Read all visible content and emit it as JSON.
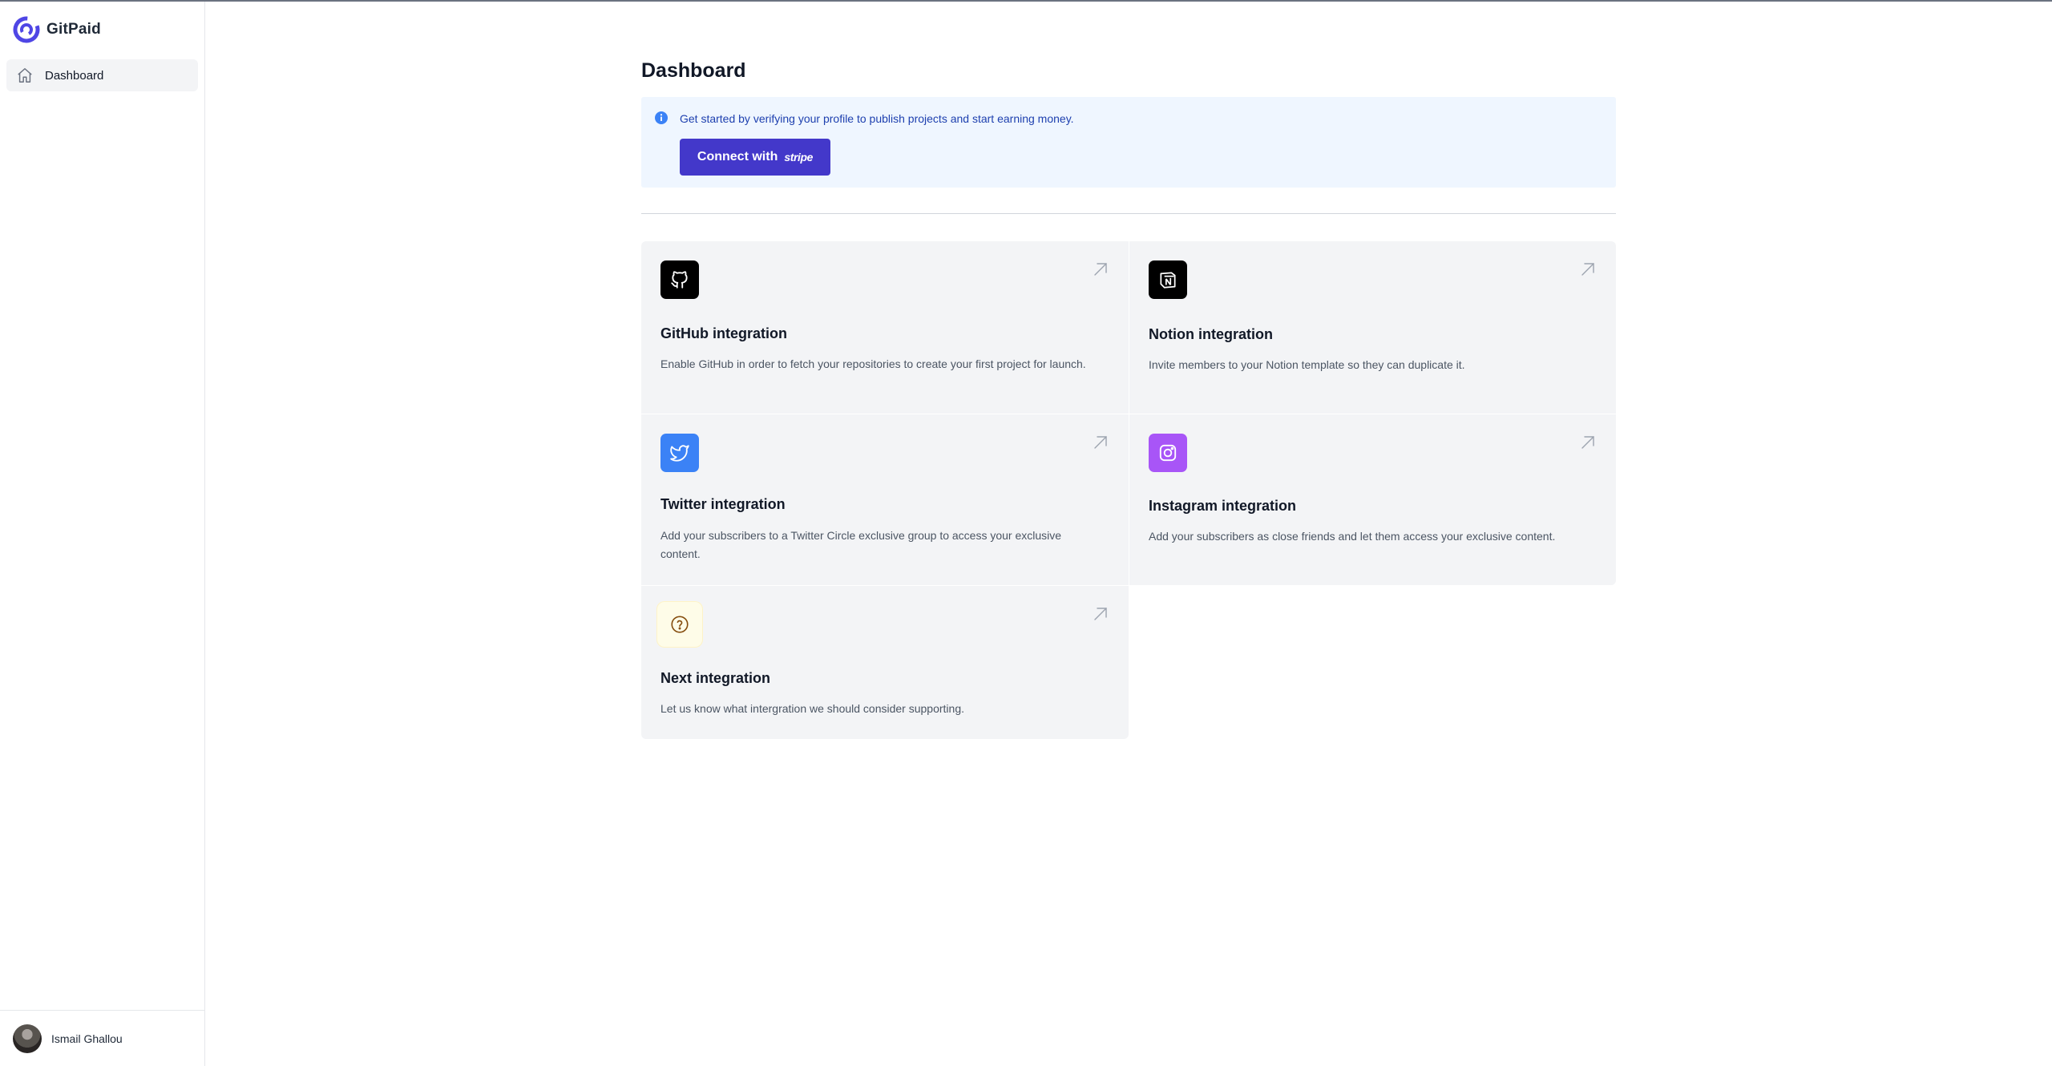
{
  "sidebar": {
    "brand": "GitPaid",
    "nav": [
      {
        "label": "Dashboard",
        "icon": "home-icon"
      }
    ],
    "user": {
      "name": "Ismail Ghallou"
    }
  },
  "main": {
    "title": "Dashboard",
    "alert": {
      "text": "Get started by verifying your profile to publish projects and start earning money.",
      "button_label": "Connect with",
      "button_brand": "stripe"
    },
    "cards": [
      {
        "title": "GitHub integration",
        "description": "Enable GitHub in order to fetch your repositories to create your first project for launch.",
        "icon": "github-icon",
        "color": "#000000"
      },
      {
        "title": "Notion integration",
        "description": "Invite members to your Notion template so they can duplicate it.",
        "icon": "notion-icon",
        "color": "#000000"
      },
      {
        "title": "Twitter integration",
        "description": "Add your subscribers to a Twitter Circle exclusive group to access your exclusive content.",
        "icon": "twitter-icon",
        "color": "#3b82f6"
      },
      {
        "title": "Instagram integration",
        "description": "Add your subscribers as close friends and let them access your exclusive content.",
        "icon": "instagram-icon",
        "color": "#a855f7"
      },
      {
        "title": "Next integration",
        "description": "Let us know what intergration we should consider supporting.",
        "icon": "question-icon",
        "color": "#fefce8"
      }
    ]
  },
  "colors": {
    "accent": "#4338ca",
    "alert_bg": "#eff6ff",
    "alert_text": "#1e40af",
    "card_bg": "#f3f4f6"
  }
}
